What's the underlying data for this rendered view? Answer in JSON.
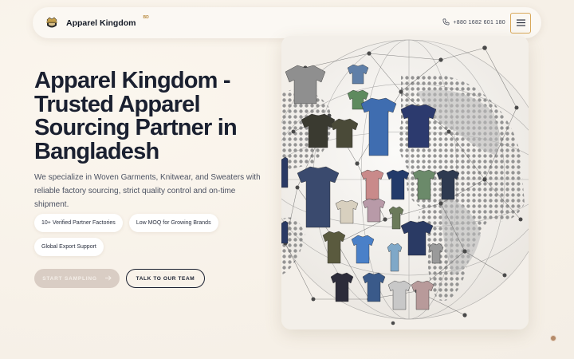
{
  "header": {
    "brand_name": "Apparel Kingdom",
    "brand_sup": "BD",
    "phone": "+880 1682 601 180",
    "logo_icon": "crest-icon",
    "phone_icon": "phone-icon",
    "menu_icon": "hamburger-icon"
  },
  "hero": {
    "title": "Apparel Kingdom - Trusted Apparel Sourcing Partner in Bangladesh",
    "description": "We specialize in Woven Garments, Knitwear, and Sweaters with reliable factory sourcing, strict quality control and on-time shipment.",
    "chips": [
      "10+ Verified Partner Factories",
      "Low MOQ for Growing Brands",
      "Global Export Support"
    ],
    "primary_button": "START SAMPLING",
    "secondary_button": "TALK TO OUR TEAM"
  },
  "colors": {
    "accent": "#d8a85a",
    "primary_button_bg": "#d9cdc4",
    "text_dark": "#1a2030",
    "background": "#f7f1e8"
  }
}
